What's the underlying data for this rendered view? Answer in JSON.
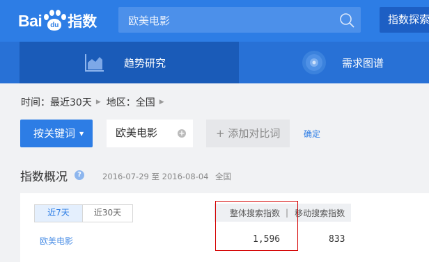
{
  "header": {
    "logo_latin": "Bai",
    "logo_du": "du",
    "logo_product": "指数",
    "search_query": "欧美电影",
    "explore_label": "指数探索"
  },
  "nav": {
    "tabs": [
      {
        "label": "趋势研究",
        "icon": "trend-chart-icon",
        "active": true
      },
      {
        "label": "需求图谱",
        "icon": "demand-graph-icon",
        "active": false
      }
    ]
  },
  "filters": {
    "time_label": "时间：最近30天",
    "region_label": "地区：全国"
  },
  "keywords": {
    "mode_button": "按关键词",
    "chip": "欧美电影",
    "add_compare": "+ 添加对比词",
    "confirm": "确定"
  },
  "overview": {
    "title": "指数概况",
    "date_range": "2016-07-29 至 2016-08-04",
    "region": "全国",
    "range_tabs": [
      "近7天",
      "近30天"
    ],
    "columns": [
      "整体搜索指数",
      "移动搜索指数"
    ],
    "column_separator": "|",
    "rows": [
      {
        "keyword": "欧美电影",
        "overall": "1,596",
        "mobile": "833"
      }
    ]
  },
  "colors": {
    "brand_blue": "#2d7de5",
    "nav_blue": "#2871d6",
    "active_nav": "#1a5bb8",
    "highlight_red": "#d40000"
  }
}
